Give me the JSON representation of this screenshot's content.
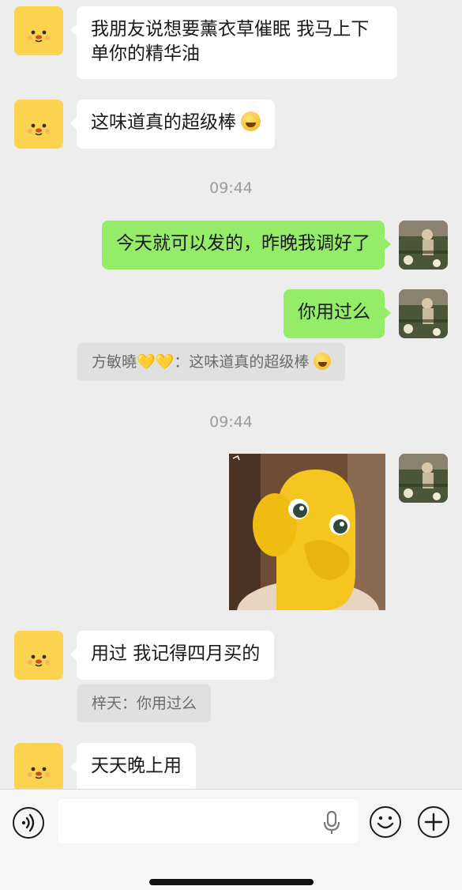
{
  "messages": {
    "m1": {
      "text": "我朋友说想要薰衣草催眠 我马上下单你的精华油"
    },
    "m2": {
      "text": "这味道真的超级棒"
    },
    "time1": "09:44",
    "m3": {
      "text": "今天就可以发的，昨晚我调好了"
    },
    "m4": {
      "text": "你用过么"
    },
    "quote1": {
      "text": "方敏曉💛💛：这味道真的超级棒"
    },
    "time2": "09:44",
    "m6": {
      "text": "用过 我记得四月买的"
    },
    "quote2": {
      "text": "梓天：你用过么"
    },
    "m7": {
      "text": "天天晚上用"
    }
  },
  "composer": {
    "input_value": "",
    "icons": [
      "voice-icon",
      "microphone-icon",
      "emoji-icon",
      "plus-icon"
    ]
  },
  "colors": {
    "background": "#ededed",
    "incoming_bubble": "#ffffff",
    "outgoing_bubble": "#95ec69",
    "quote_bg": "#e0e0e0",
    "timestamp": "#9b9b9b"
  }
}
